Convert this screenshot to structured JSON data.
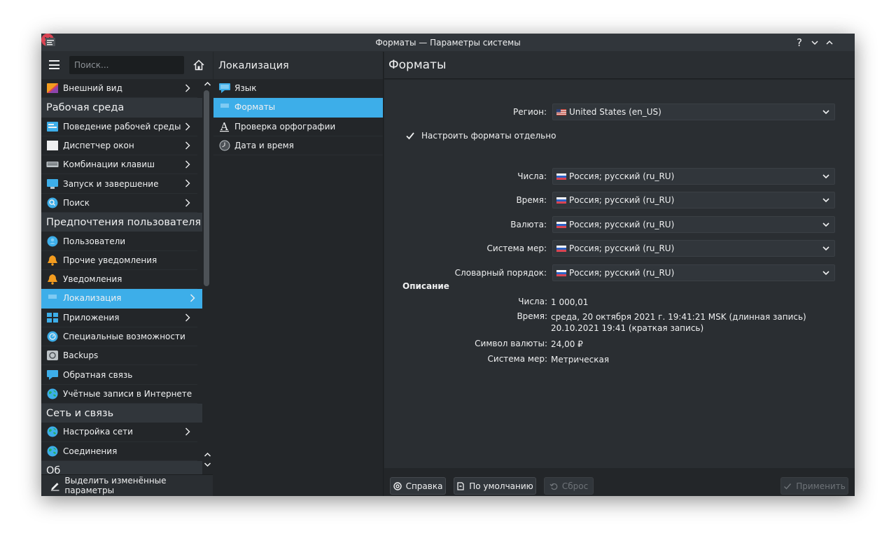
{
  "window": {
    "title": "Форматы — Параметры системы"
  },
  "sidebar": {
    "search_placeholder": "Поиск...",
    "items": [
      {
        "type": "item",
        "label": "Внешний вид",
        "icon": "appearance-icon",
        "chevron": true
      },
      {
        "type": "category",
        "label": "Рабочая среда"
      },
      {
        "type": "item",
        "label": "Поведение рабочей среды",
        "icon": "desktop-behavior-icon",
        "chevron": true
      },
      {
        "type": "item",
        "label": "Диспетчер окон",
        "icon": "window-manager-icon",
        "chevron": true
      },
      {
        "type": "item",
        "label": "Комбинации клавиш",
        "icon": "keyboard-icon",
        "chevron": true
      },
      {
        "type": "item",
        "label": "Запуск и завершение",
        "icon": "startup-icon",
        "chevron": true
      },
      {
        "type": "item",
        "label": "Поиск",
        "icon": "search-icon",
        "chevron": true
      },
      {
        "type": "category",
        "label": "Предпочтения пользователя"
      },
      {
        "type": "item",
        "label": "Пользователи",
        "icon": "users-icon",
        "chevron": false
      },
      {
        "type": "item",
        "label": "Прочие уведомления",
        "icon": "bell-icon",
        "chevron": false
      },
      {
        "type": "item",
        "label": "Уведомления",
        "icon": "bell-icon",
        "chevron": false
      },
      {
        "type": "item",
        "label": "Локализация",
        "icon": "localization-icon",
        "chevron": true,
        "active": true
      },
      {
        "type": "item",
        "label": "Приложения",
        "icon": "applications-icon",
        "chevron": true
      },
      {
        "type": "item",
        "label": "Специальные возможности",
        "icon": "accessibility-icon",
        "chevron": false
      },
      {
        "type": "item",
        "label": "Backups",
        "icon": "backup-icon",
        "chevron": false
      },
      {
        "type": "item",
        "label": "Обратная связь",
        "icon": "feedback-icon",
        "chevron": false
      },
      {
        "type": "item",
        "label": "Учётные записи в Интернете",
        "icon": "globe-icon",
        "chevron": false
      },
      {
        "type": "category",
        "label": "Сеть и связь"
      },
      {
        "type": "item",
        "label": "Настройка сети",
        "icon": "globe-icon",
        "chevron": true
      },
      {
        "type": "item",
        "label": "Соединения",
        "icon": "globe-icon",
        "chevron": false
      },
      {
        "type": "category",
        "label": "Об"
      }
    ],
    "footer_label": "Выделить изменённые параметры"
  },
  "middle": {
    "title": "Локализация",
    "items": [
      {
        "label": "Язык",
        "icon": "language-icon"
      },
      {
        "label": "Форматы",
        "icon": "localization-icon",
        "active": true
      },
      {
        "label": "Проверка орфографии",
        "icon": "spellcheck-icon"
      },
      {
        "label": "Дата и время",
        "icon": "clock-icon"
      }
    ]
  },
  "right": {
    "title": "Форматы",
    "region_label": "Регион:",
    "region_value": "United States (en_US)",
    "separate_label": "Настроить форматы отдельно",
    "rows": [
      {
        "label": "Числа:",
        "value": "Россия; русский (ru_RU)"
      },
      {
        "label": "Время:",
        "value": "Россия; русский (ru_RU)"
      },
      {
        "label": "Валюта:",
        "value": "Россия; русский (ru_RU)"
      },
      {
        "label": "Система мер:",
        "value": "Россия; русский (ru_RU)"
      },
      {
        "label": "Словарный порядок:",
        "value": "Россия; русский (ru_RU)"
      }
    ],
    "description": {
      "title": "Описание",
      "numbers_label": "Числа:",
      "numbers_value": "1 000,01",
      "time_label": "Время:",
      "time_long": "среда, 20 октября 2021 г. 19:41:21 MSK (длинная запись)",
      "time_short": "20.10.2021 19:41 (краткая запись)",
      "currency_label": "Символ валюты:",
      "currency_value": "24,00 ₽",
      "measure_label": "Система мер:",
      "measure_value": "Метрическая"
    },
    "buttons": {
      "help": "Справка",
      "defaults": "По умолчанию",
      "reset": "Сброс",
      "apply": "Применить"
    }
  },
  "colors": {
    "accent": "#3daee9",
    "close": "#da4453",
    "background": "#232629",
    "panel": "#2a2e32"
  }
}
